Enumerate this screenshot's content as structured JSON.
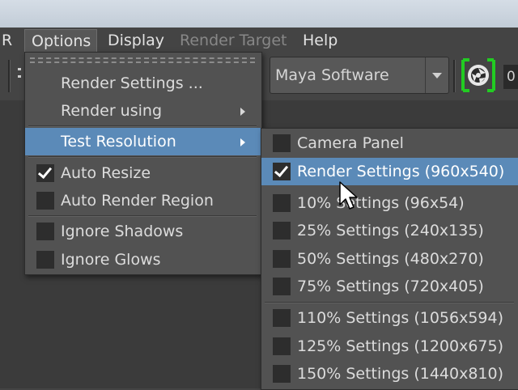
{
  "menubar": {
    "items": [
      {
        "label": "R",
        "state": "normal"
      },
      {
        "label": "Options",
        "state": "active"
      },
      {
        "label": "Display",
        "state": "normal"
      },
      {
        "label": "Render Target",
        "state": "disabled"
      },
      {
        "label": "Help",
        "state": "normal"
      }
    ]
  },
  "toolbar": {
    "renderer": "Maya Software",
    "field_value": "0",
    "camera_icon": "render-camera-icon"
  },
  "options_menu": {
    "items": [
      {
        "label": "Render Settings ...",
        "type": "command"
      },
      {
        "label": "Render using",
        "type": "submenu"
      },
      {
        "label": "Test Resolution",
        "type": "submenu",
        "highlighted": true
      },
      {
        "label": "Auto Resize",
        "type": "checkbox",
        "checked": true
      },
      {
        "label": "Auto Render Region",
        "type": "checkbox",
        "checked": false
      },
      {
        "label": "Ignore Shadows",
        "type": "checkbox",
        "checked": false
      },
      {
        "label": "Ignore Glows",
        "type": "checkbox",
        "checked": false
      }
    ]
  },
  "test_resolution_menu": {
    "items": [
      {
        "label": "Camera Panel",
        "checked": false
      },
      {
        "label": "Render Settings (960x540)",
        "checked": true,
        "highlighted": true
      },
      {
        "label": "10% Settings (96x54)",
        "checked": false
      },
      {
        "label": "25% Settings (240x135)",
        "checked": false
      },
      {
        "label": "50% Settings (480x270)",
        "checked": false
      },
      {
        "label": "75% Settings (720x405)",
        "checked": false
      },
      {
        "label": "110% Settings (1056x594)",
        "checked": false
      },
      {
        "label": "125% Settings (1200x675)",
        "checked": false
      },
      {
        "label": "150% Settings (1440x810)",
        "checked": false
      }
    ]
  },
  "colors": {
    "highlight": "#5b8ab8",
    "menu_bg": "#525252",
    "camera_bracket": "#22cc22"
  }
}
